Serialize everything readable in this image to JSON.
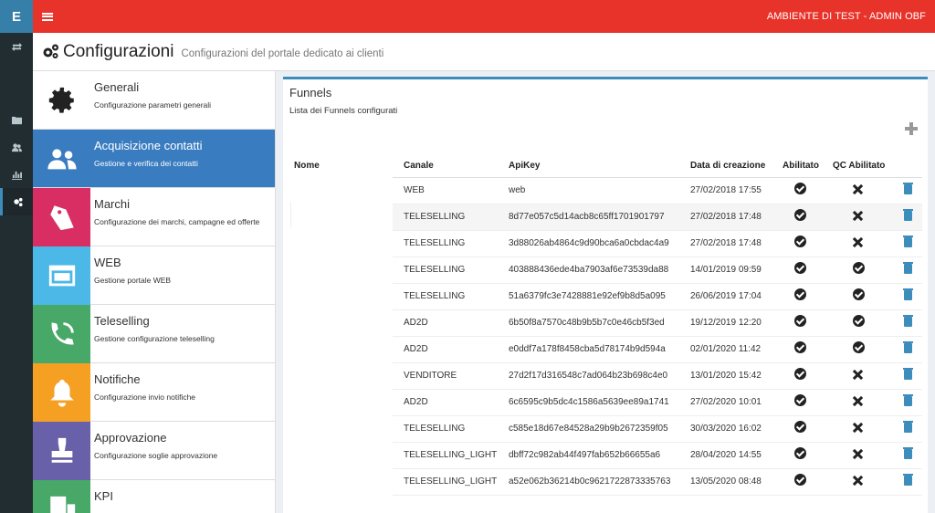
{
  "app_logo": "E",
  "topbar": {
    "env_label": "AMBIENTE DI TEST - ADMIN OBF"
  },
  "page": {
    "title": "Configurazioni",
    "subtitle": "Configurazioni del portale dedicato ai clienti"
  },
  "menu": [
    {
      "title": "Generali",
      "desc": "Configurazione parametri generali",
      "color": "#ffffff",
      "icon": "gear-icon"
    },
    {
      "title": "Acquisizione contatti",
      "desc": "Gestione e verifica dei contatti",
      "color": "#3a7cc0",
      "icon": "users-icon"
    },
    {
      "title": "Marchi",
      "desc": "Configurazione dei marchi, campagne ed offerte",
      "color": "#d82e64",
      "icon": "tags-icon"
    },
    {
      "title": "WEB",
      "desc": "Gestione portale WEB",
      "color": "#4bb8e8",
      "icon": "web-icon"
    },
    {
      "title": "Teleselling",
      "desc": "Gestione configurazione teleselling",
      "color": "#47a868",
      "icon": "phone-icon"
    },
    {
      "title": "Notifiche",
      "desc": "Configurazione invio notifiche",
      "color": "#f5a023",
      "icon": "bell-icon"
    },
    {
      "title": "Approvazione",
      "desc": "Configurazione soglie approvazione",
      "color": "#6860a9",
      "icon": "stamp-icon"
    },
    {
      "title": "KPI",
      "desc": "",
      "color": "#47a868",
      "icon": "building-icon"
    }
  ],
  "funnels": {
    "title": "Funnels",
    "subtitle": "Lista dei Funnels configurati",
    "headers": {
      "nome": "Nome",
      "canale": "Canale",
      "apikey": "ApiKey",
      "data": "Data di creazione",
      "abilitato": "Abilitato",
      "qc": "QC Abilitato"
    },
    "rows": [
      {
        "canale": "WEB",
        "apikey": "web",
        "data": "27/02/2018 17:55",
        "abilitato": true,
        "qc": false
      },
      {
        "canale": "TELESELLING",
        "apikey": "8d77e057c5d14acb8c65ff1701901797",
        "data": "27/02/2018 17:48",
        "abilitato": true,
        "qc": false
      },
      {
        "canale": "TELESELLING",
        "apikey": "3d88026ab4864c9d90bca6a0cbdac4a9",
        "data": "27/02/2018 17:48",
        "abilitato": true,
        "qc": false
      },
      {
        "canale": "TELESELLING",
        "apikey": "403888436ede4ba7903af6e73539da88",
        "data": "14/01/2019 09:59",
        "abilitato": true,
        "qc": true
      },
      {
        "canale": "TELESELLING",
        "apikey": "51a6379fc3e7428881e92ef9b8d5a095",
        "data": "26/06/2019 17:04",
        "abilitato": true,
        "qc": true
      },
      {
        "canale": "AD2D",
        "apikey": "6b50f8a7570c48b9b5b7c0e46cb5f3ed",
        "data": "19/12/2019 12:20",
        "abilitato": true,
        "qc": true
      },
      {
        "canale": "AD2D",
        "apikey": "e0ddf7a178f8458cba5d78174b9d594a",
        "data": "02/01/2020 11:42",
        "abilitato": true,
        "qc": true
      },
      {
        "canale": "VENDITORE",
        "apikey": "27d2f17d316548c7ad064b23b698c4e0",
        "data": "13/01/2020 15:42",
        "abilitato": true,
        "qc": false
      },
      {
        "canale": "AD2D",
        "apikey": "6c6595c9b5dc4c1586a5639ee89a1741",
        "data": "27/02/2020 10:01",
        "abilitato": true,
        "qc": false
      },
      {
        "canale": "TELESELLING",
        "apikey": "c585e18d67e84528a29b9b2672359f05",
        "data": "30/03/2020 16:02",
        "abilitato": true,
        "qc": false
      },
      {
        "canale": "TELESELLING_LIGHT",
        "apikey": "dbff72c982ab44f497fab652b66655a6",
        "data": "28/04/2020 14:55",
        "abilitato": true,
        "qc": false
      },
      {
        "canale": "TELESELLING_LIGHT",
        "apikey": "a52e062b36214b0c9621722873335763",
        "data": "13/05/2020 08:48",
        "abilitato": true,
        "qc": false
      }
    ]
  }
}
